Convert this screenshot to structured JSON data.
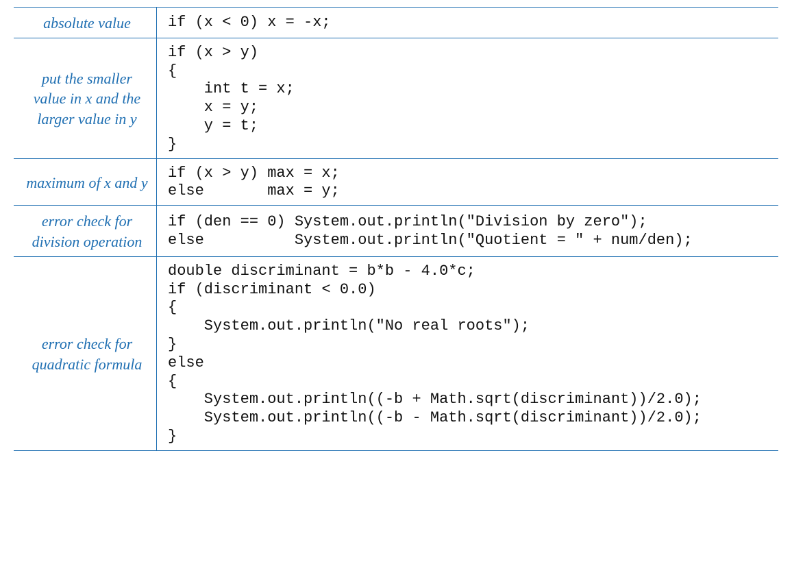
{
  "rows": [
    {
      "desc": "absolute value",
      "code": "if (x < 0) x = -x;"
    },
    {
      "desc": "put the smaller\nvalue in x\nand the larger\nvalue in y",
      "code": "if (x > y)\n{\n    int t = x;\n    x = y;\n    y = t;\n}"
    },
    {
      "desc": "maximum of\nx and y",
      "code": "if (x > y) max = x;\nelse       max = y;"
    },
    {
      "desc": "error check\nfor division\noperation",
      "code": "if (den == 0) System.out.println(\"Division by zero\");\nelse          System.out.println(\"Quotient = \" + num/den);"
    },
    {
      "desc": "error check\nfor quadratic\nformula",
      "code": "double discriminant = b*b - 4.0*c;\nif (discriminant < 0.0)\n{\n    System.out.println(\"No real roots\");\n}\nelse\n{\n    System.out.println((-b + Math.sqrt(discriminant))/2.0);\n    System.out.println((-b - Math.sqrt(discriminant))/2.0);\n}"
    }
  ]
}
